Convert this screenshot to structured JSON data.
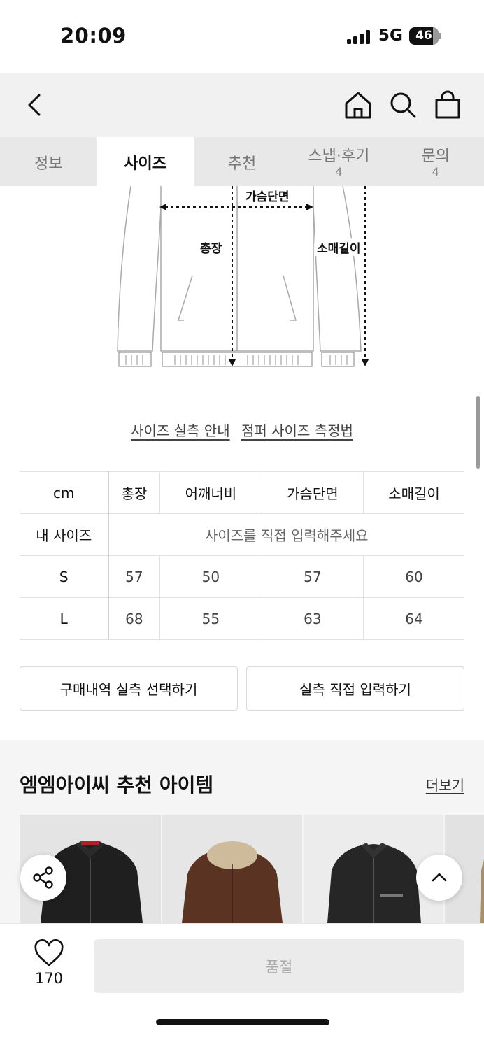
{
  "status_bar": {
    "time": "20:09",
    "network": "5G",
    "battery": "46"
  },
  "tabs": [
    {
      "label": "정보",
      "count": ""
    },
    {
      "label": "사이즈",
      "count": ""
    },
    {
      "label": "추천",
      "count": ""
    },
    {
      "label": "스냅·후기",
      "count": "4"
    },
    {
      "label": "문의",
      "count": "4"
    }
  ],
  "diagram": {
    "chest": "가슴단면",
    "length": "총장",
    "sleeve": "소매길이"
  },
  "links": {
    "guide": "사이즈 실측 안내",
    "method": "점퍼 사이즈 측정법"
  },
  "size_table": {
    "unit": "cm",
    "columns": [
      "총장",
      "어깨너비",
      "가슴단면",
      "소매길이"
    ],
    "my_size_label": "내 사이즈",
    "my_size_placeholder": "사이즈를 직접 입력해주세요",
    "rows": [
      {
        "size": "S",
        "values": [
          "57",
          "50",
          "57",
          "60"
        ]
      },
      {
        "size": "L",
        "values": [
          "68",
          "55",
          "63",
          "64"
        ]
      }
    ]
  },
  "actions": {
    "purchase_history": "구매내역 실측 선택하기",
    "manual_input": "실측 직접 입력하기"
  },
  "recommendations": {
    "title": "엠엠아이씨 추천 아이템",
    "more": "더보기"
  },
  "bottom": {
    "like_count": "170",
    "sold_out": "품절"
  }
}
